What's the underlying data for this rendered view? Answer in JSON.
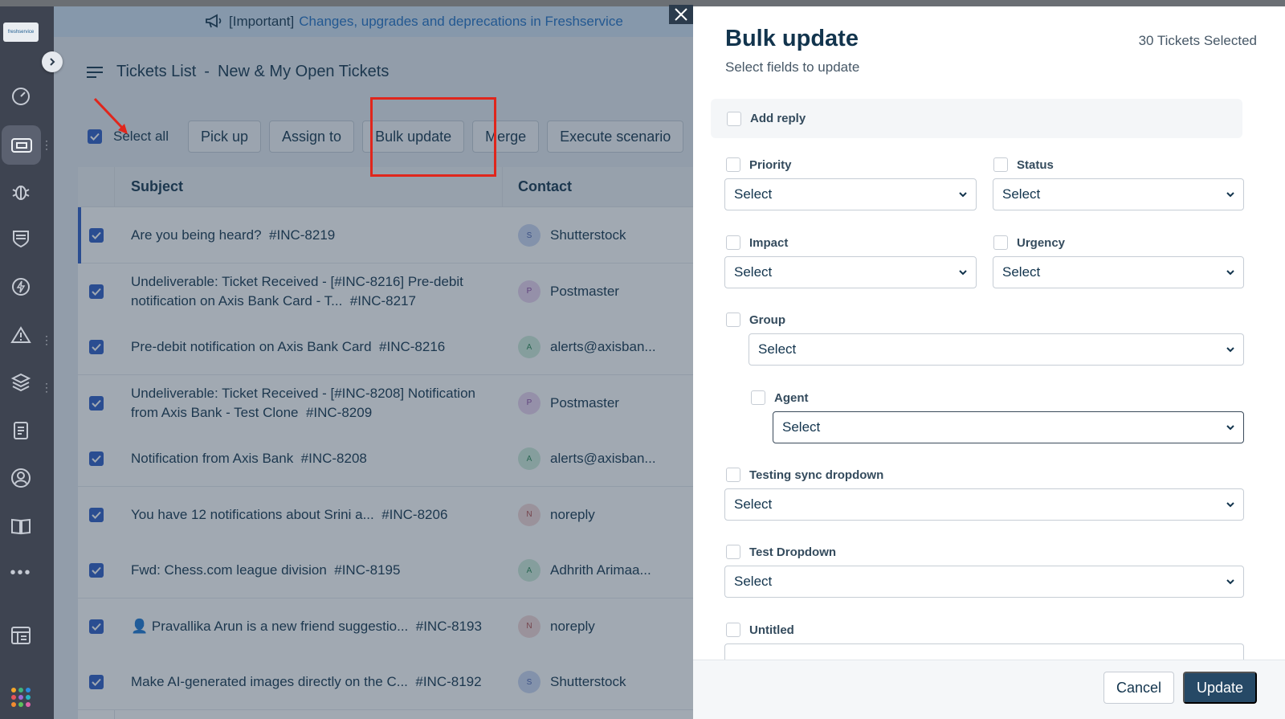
{
  "app": {
    "logo_text": "freshservice"
  },
  "banner": {
    "tag": "[Important]",
    "link": "Changes, upgrades and deprecations in Freshservice"
  },
  "header": {
    "title": "Tickets List",
    "separator": "-",
    "view_name": "New & My Open Tickets"
  },
  "toolbar": {
    "select_all_label": "Select all",
    "buttons": [
      "Pick up",
      "Assign to",
      "Bulk update",
      "Merge",
      "Execute scenario"
    ]
  },
  "table": {
    "columns": [
      "Subject",
      "Contact"
    ],
    "rows": [
      {
        "subject": "Are you being heard?",
        "id": "#INC-8219",
        "contact": "Shutterstock",
        "initial": "S"
      },
      {
        "subject": "Undeliverable: Ticket Received - [#INC-8216] Pre-debit notification on Axis Bank Card - T...",
        "id": "#INC-8217",
        "contact": "Postmaster",
        "initial": "P"
      },
      {
        "subject": "Pre-debit notification on Axis Bank Card",
        "id": "#INC-8216",
        "contact": "alerts@axisban...",
        "initial": "A"
      },
      {
        "subject": "Undeliverable: Ticket Received - [#INC-8208] Notification from Axis Bank - Test Clone",
        "id": "#INC-8209",
        "contact": "Postmaster",
        "initial": "P"
      },
      {
        "subject": "Notification from Axis Bank",
        "id": "#INC-8208",
        "contact": "alerts@axisban...",
        "initial": "A"
      },
      {
        "subject": "You have 12 notifications about Srini a...",
        "id": "#INC-8206",
        "contact": "noreply",
        "initial": "N"
      },
      {
        "subject": "Fwd: Chess.com league division",
        "id": "#INC-8195",
        "contact": "Adhrith Arimaa...",
        "initial": "A"
      },
      {
        "subject": "👤 Pravallika Arun is a new friend suggestio...",
        "id": "#INC-8193",
        "contact": "noreply",
        "initial": "N"
      },
      {
        "subject": "Make AI-generated images directly on the C...",
        "id": "#INC-8192",
        "contact": "Shutterstock",
        "initial": "S"
      }
    ]
  },
  "panel": {
    "title": "Bulk update",
    "subtitle": "Select fields to update",
    "count": "30 Tickets Selected",
    "add_reply": "Add reply",
    "fields": {
      "priority": {
        "label": "Priority",
        "value": "Select"
      },
      "status": {
        "label": "Status",
        "value": "Select"
      },
      "impact": {
        "label": "Impact",
        "value": "Select"
      },
      "urgency": {
        "label": "Urgency",
        "value": "Select"
      },
      "group": {
        "label": "Group",
        "value": "Select"
      },
      "agent": {
        "label": "Agent",
        "value": "Select"
      },
      "testing_sync": {
        "label": "Testing sync dropdown",
        "value": "Select"
      },
      "test_dropdown": {
        "label": "Test Dropdown",
        "value": "Select"
      },
      "untitled": {
        "label": "Untitled"
      }
    },
    "cancel_label": "Cancel",
    "update_label": "Update"
  },
  "colors": {
    "primary": "#2c5cc5",
    "update_button": "#264966",
    "sidebar": "#3e4451",
    "highlight": "#e0261c"
  }
}
